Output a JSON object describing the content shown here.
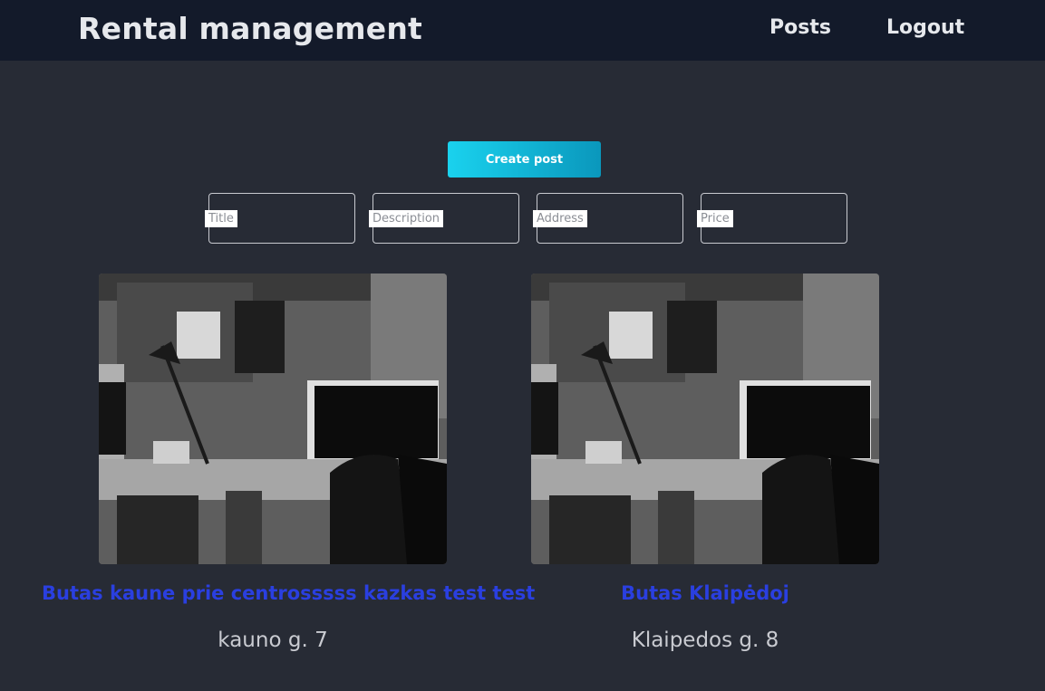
{
  "navbar": {
    "brand": "Rental management",
    "links": [
      {
        "label": "Posts"
      },
      {
        "label": "Logout"
      }
    ]
  },
  "create_button": {
    "label": "Create post"
  },
  "form": {
    "fields": [
      {
        "label": "Title",
        "value": ""
      },
      {
        "label": "Description",
        "value": ""
      },
      {
        "label": "Address",
        "value": ""
      },
      {
        "label": "Price",
        "value": ""
      }
    ]
  },
  "posts": [
    {
      "title": "Butas kaune prie centrosssss kazkas test test",
      "address": "kauno g. 7",
      "image": "office-photo"
    },
    {
      "title": "Butas Klaipėdoj",
      "address": "Klaipedos g. 8",
      "image": "office-photo"
    }
  ],
  "colors": {
    "background": "#272b35",
    "navbar": "#131a2a",
    "accent_gradient_start": "#1ad2ee",
    "accent_gradient_end": "#0a97bc",
    "post_title": "#2a3fe0"
  }
}
